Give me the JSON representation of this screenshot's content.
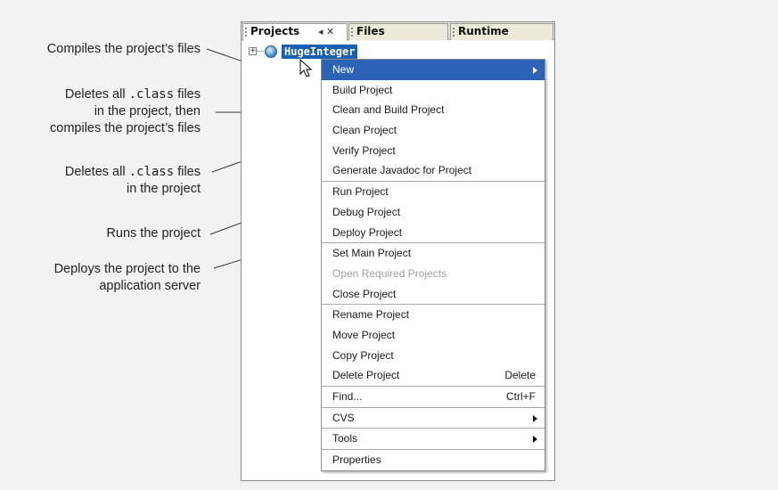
{
  "callouts": {
    "build": "Compiles the project’s files",
    "clean_build_1a": "Deletes all ",
    "clean_build_1b": ".class",
    "clean_build_1c": " files",
    "clean_build_2": "in the project, then",
    "clean_build_3": "compiles the project’s files",
    "clean_1a": "Deletes all ",
    "clean_1b": ".class",
    "clean_1c": " files",
    "clean_2": "in the project",
    "run": "Runs the project",
    "deploy_1": "Deploys the project to the",
    "deploy_2": "application server"
  },
  "tabs": {
    "projects": "Projects",
    "projects_controls": "◂ ✕",
    "files": "Files",
    "runtime": "Runtime"
  },
  "tree": {
    "expand": "+",
    "project_name": "HugeInteger"
  },
  "menu": {
    "new": "New",
    "build": "Build Project",
    "clean_build": "Clean and Build Project",
    "clean": "Clean Project",
    "verify": "Verify Project",
    "javadoc": "Generate Javadoc for Project",
    "run": "Run Project",
    "debug": "Debug Project",
    "deploy": "Deploy Project",
    "set_main": "Set Main Project",
    "open_required": "Open Required Projects",
    "close": "Close Project",
    "rename": "Rename Project",
    "move": "Move Project",
    "copy": "Copy Project",
    "delete": "Delete Project",
    "delete_shortcut": "Delete",
    "find": "Find...",
    "find_shortcut": "Ctrl+F",
    "cvs": "CVS",
    "tools": "Tools",
    "properties": "Properties"
  },
  "colors": {
    "selection": "#2d63b6",
    "tree_selection": "#1b5fb0",
    "tab_bar": "#e4e2da",
    "disabled_text": "#a0a0a0"
  }
}
